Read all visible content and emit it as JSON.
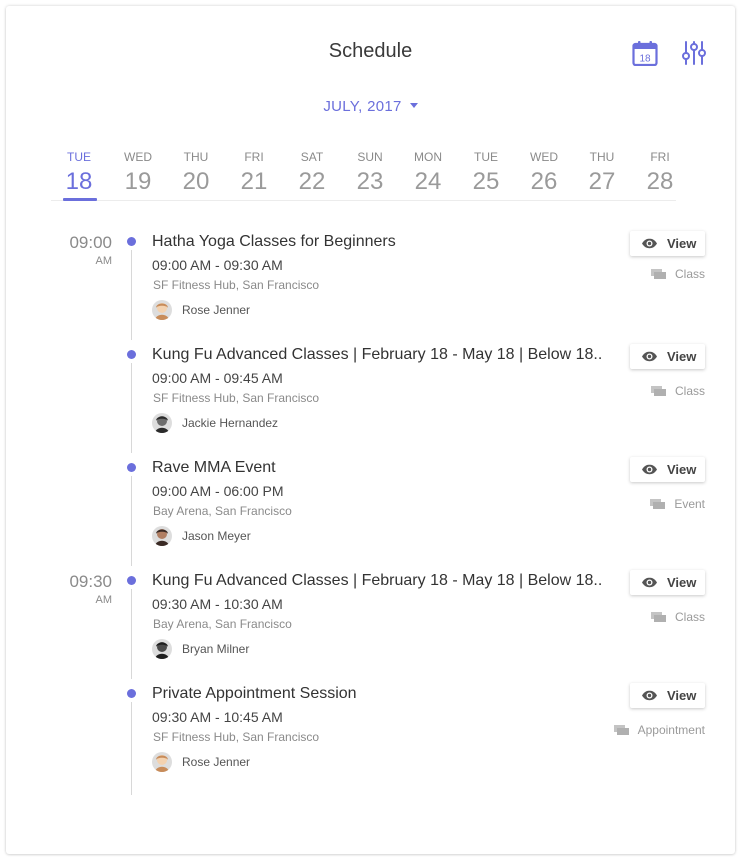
{
  "header": {
    "title": "Schedule",
    "calendar_icon_day": "18"
  },
  "month_selector": {
    "label": "JULY, 2017"
  },
  "days": [
    {
      "name": "TUE",
      "num": "18",
      "active": true
    },
    {
      "name": "WED",
      "num": "19"
    },
    {
      "name": "THU",
      "num": "20"
    },
    {
      "name": "FRI",
      "num": "21"
    },
    {
      "name": "SAT",
      "num": "22"
    },
    {
      "name": "SUN",
      "num": "23"
    },
    {
      "name": "MON",
      "num": "24"
    },
    {
      "name": "TUE",
      "num": "25"
    },
    {
      "name": "WED",
      "num": "26"
    },
    {
      "name": "THU",
      "num": "27"
    },
    {
      "name": "FRI",
      "num": "28"
    }
  ],
  "time_groups": [
    {
      "time": "09:00",
      "ampm": "AM"
    },
    {
      "time": "09:30",
      "ampm": "AM"
    }
  ],
  "events": [
    {
      "title": "Hatha Yoga Classes for Beginners",
      "time": "09:00 AM - 09:30 AM",
      "location": "SF Fitness Hub, San Francisco",
      "person": "Rose Jenner",
      "type": "Class",
      "view": "View"
    },
    {
      "title": "Kung Fu Advanced Classes | February 18 - May 18 | Below 18..",
      "time": "09:00 AM - 09:45 AM",
      "location": "SF Fitness Hub, San Francisco",
      "person": "Jackie Hernandez",
      "type": "Class",
      "view": "View"
    },
    {
      "title": "Rave MMA Event",
      "time": "09:00 AM - 06:00 PM",
      "location": "Bay Arena, San Francisco",
      "person": "Jason Meyer",
      "type": "Event",
      "view": "View"
    },
    {
      "title": "Kung Fu Advanced Classes | February 18 - May 18 | Below 18..",
      "time": "09:30 AM - 10:30 AM",
      "location": "Bay Arena, San Francisco",
      "person": "Bryan Milner",
      "type": "Class",
      "view": "View"
    },
    {
      "title": "Private Appointment Session",
      "time": "09:30 AM - 10:45 AM",
      "location": "SF Fitness Hub, San Francisco",
      "person": "Rose Jenner",
      "type": "Appointment",
      "view": "View"
    }
  ],
  "colors": {
    "accent": "#6b6fdc",
    "muted": "#8a8a8a"
  }
}
